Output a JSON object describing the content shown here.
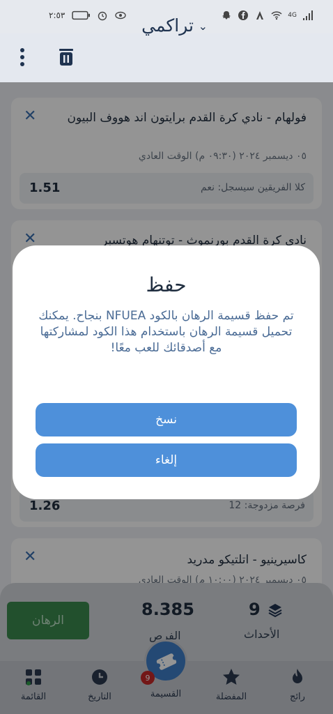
{
  "status_bar": {
    "time": "٢:٥٣",
    "network": "4G"
  },
  "header": {
    "title": "تراكمي"
  },
  "cards": [
    {
      "title": "فولهام - نادي كرة القدم برايتون اند هووف البيون",
      "date": "٠٥ ديسمبر ٢٠٢٤ (٠٩:٣٠ م) الوقت العادي",
      "bet_label": "كلا الفريقين سيسجل: نعم",
      "odd": "1.51"
    },
    {
      "title": "نادي كرة القدم بورنموث - توتنهام هوتسبر",
      "bet_label": "فرصة مزدوجة: 12",
      "odd": "1.26"
    },
    {
      "title": "كاسيرينيو - اتلتيكو مدريد",
      "date": "٠٥ ديسمبر ٢٠٢٤ (١٠:٠٠ م) الوقت العادي"
    }
  ],
  "dialog": {
    "title": "حفظ",
    "message": "تم حفظ قسيمة الرهان بالكود NFUEA بنجاح. يمكنك تحميل قسيمة الرهان باستخدام هذا الكود لمشاركتها مع أصدقائك للعب معًا!",
    "copy_label": "نسخ",
    "cancel_label": "إلغاء"
  },
  "bet_panel": {
    "bet_button_label": "الرهان",
    "odds_value": "8.385",
    "odds_label": "الفرص",
    "events_value": "9",
    "events_label": "الأحداث"
  },
  "nav": {
    "items": [
      {
        "label": "القائمة",
        "icon": "grid-icon"
      },
      {
        "label": "التاريخ",
        "icon": "clock-icon"
      },
      {
        "label": "القسيمة",
        "icon": "ticket-icon",
        "badge": "9"
      },
      {
        "label": "المفضلة",
        "icon": "star-icon"
      },
      {
        "label": "رائج",
        "icon": "fire-icon"
      }
    ]
  },
  "colors": {
    "accent": "#4e90da",
    "bet_green": "#3b8a4e",
    "badge_red": "#c62828"
  }
}
